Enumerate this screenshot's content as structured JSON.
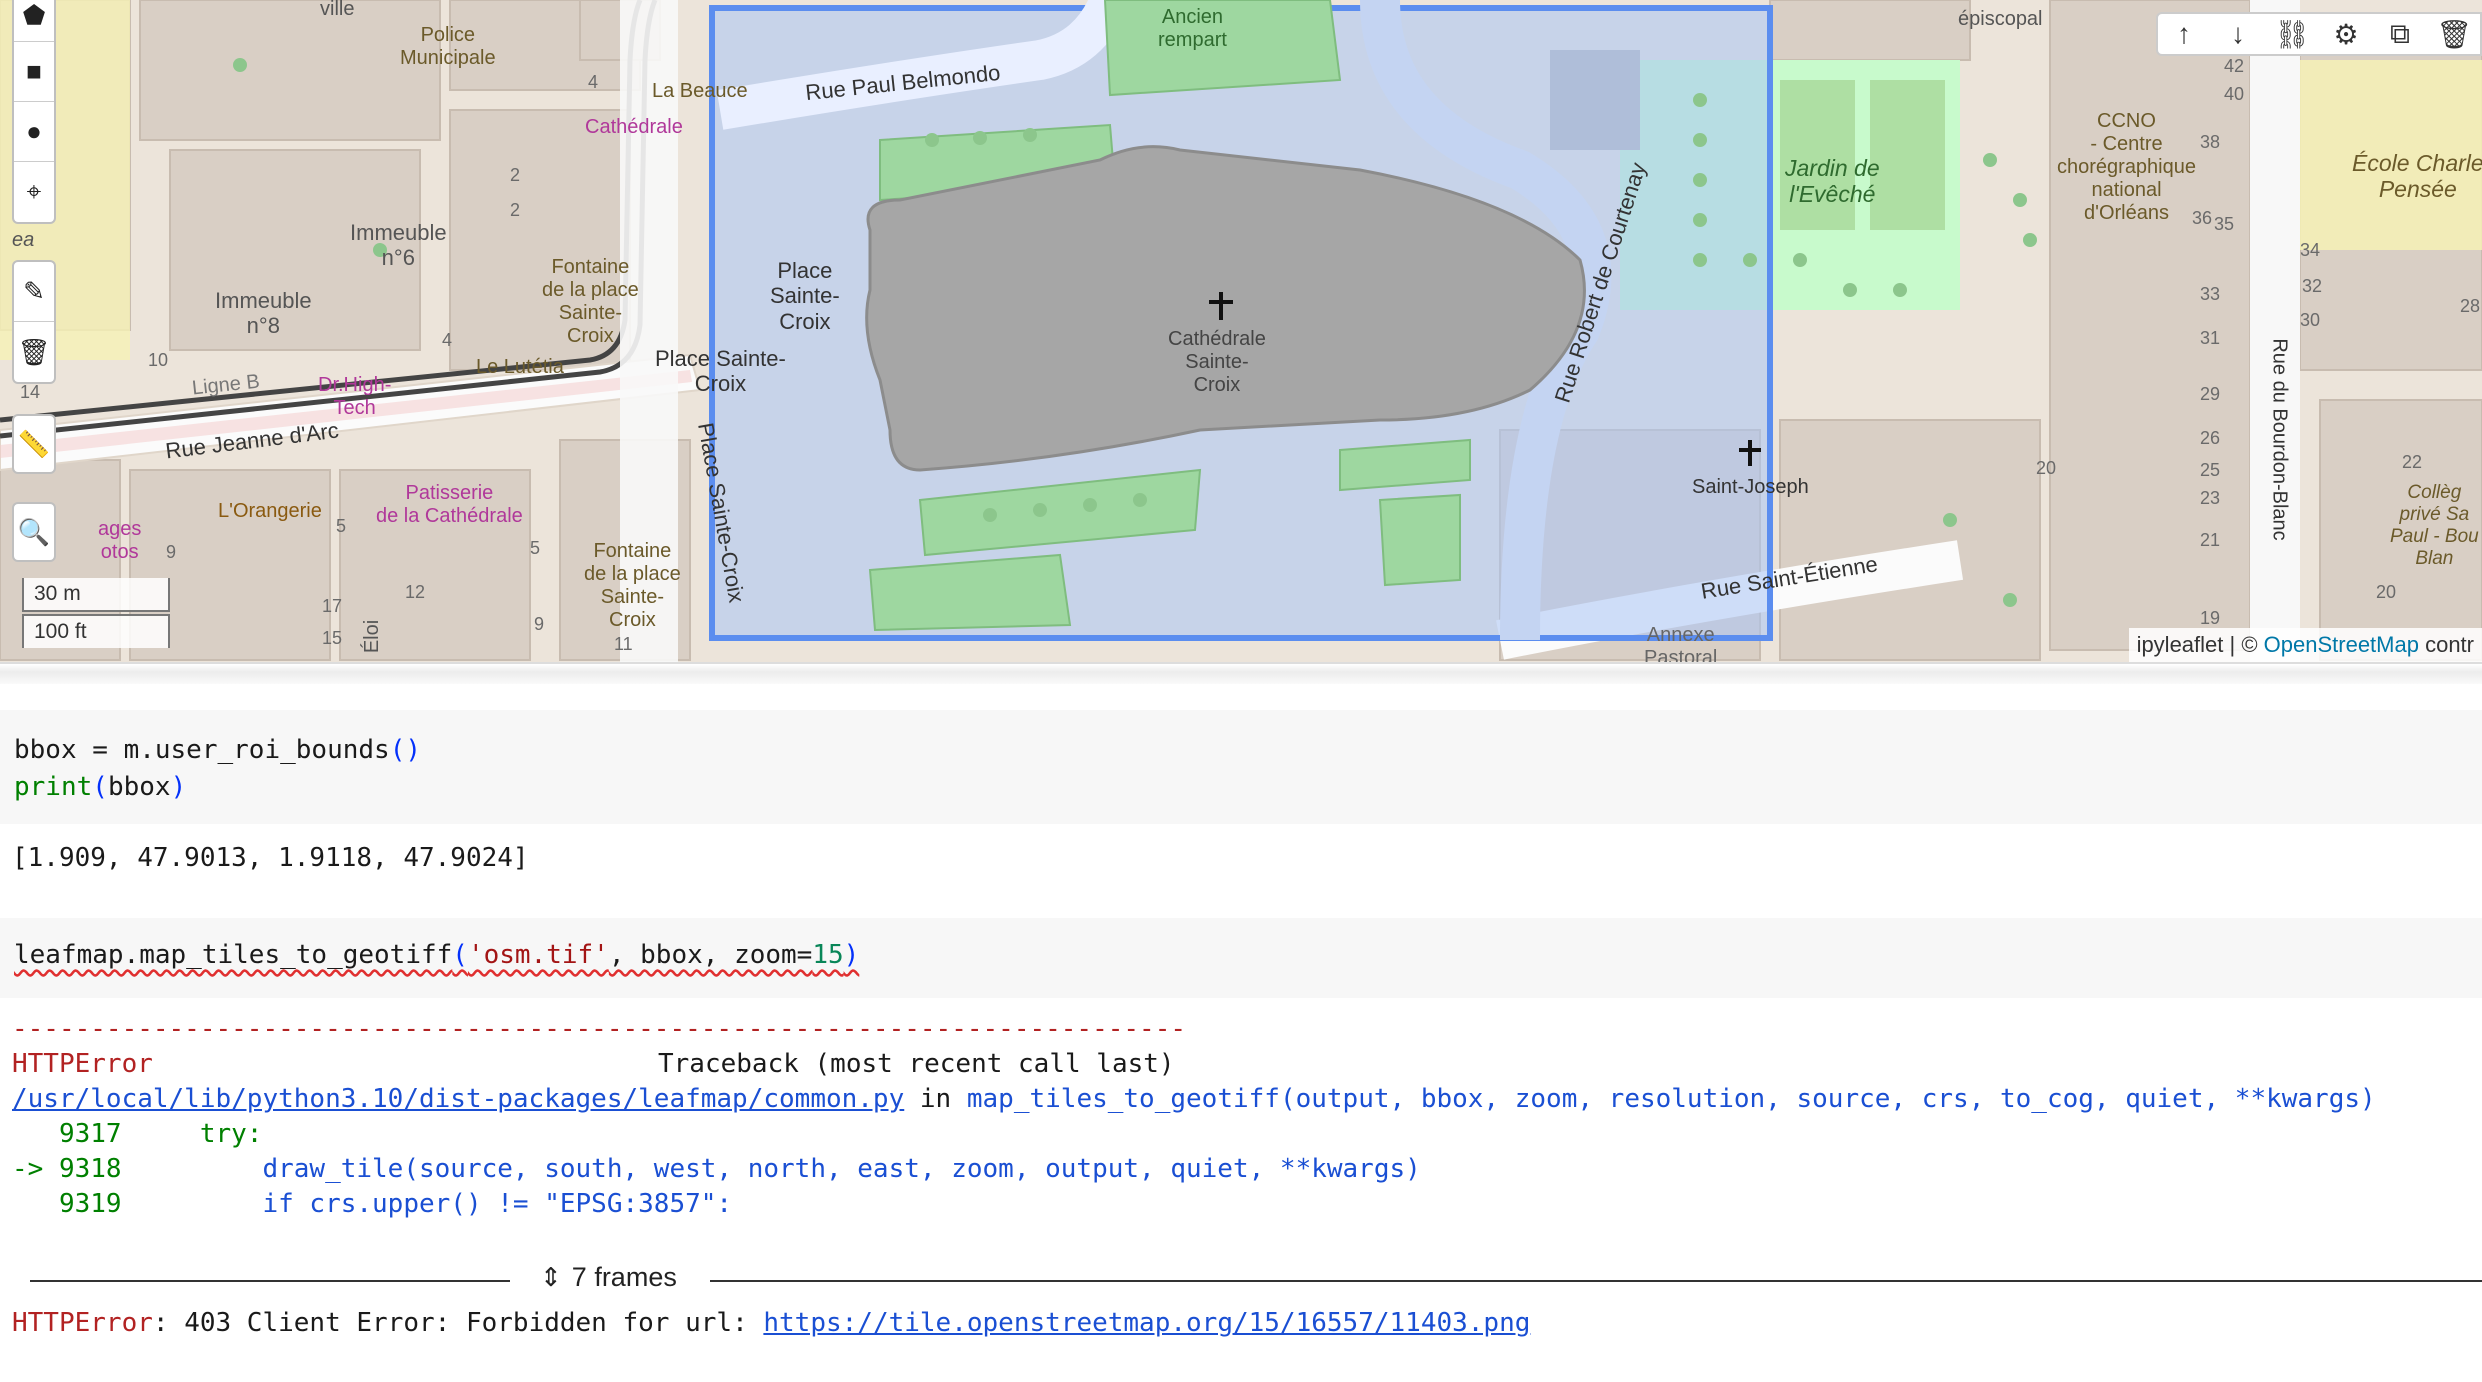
{
  "map": {
    "top_toolbar": [
      "arrow-up-icon",
      "arrow-down-icon",
      "link-icon",
      "gear-icon",
      "layers-icon",
      "trash-icon"
    ],
    "draw_toolbar": [
      "polygon-icon",
      "rectangle-icon",
      "circle-icon",
      "marker-icon",
      "edit-icon",
      "delete-icon"
    ],
    "scale": {
      "metric": "30 m",
      "imperial": "100 ft"
    },
    "attribution": {
      "prefix": "ipyleaflet | © ",
      "link": "OpenStreetMap",
      "suffix": " contr"
    },
    "labels": {
      "ville": "ville",
      "police": "Police\nMunicipale",
      "cathedrale_small": "Cathédrale",
      "la_beauce": "La Beauce",
      "ancien_rempart": "Ancien\nrempart",
      "episcopal": "épiscopal",
      "rue_paul_belmondo": "Rue Paul Belmondo",
      "immeuble_n6": "Immeuble\nn°6",
      "immeuble_n8": "Immeuble\nn°8",
      "fontaine_1": "Fontaine\nde la place\nSainte-\nCroix",
      "le_lutetia": "Le Lutétia",
      "ligne_b": "Ligne B",
      "dr_high_tech": "Dr.High-\nTech",
      "rue_jeanne": "Rue Jeanne d'Arc",
      "lorangerie": "L'Orangerie",
      "patisserie": "Patisserie\nde la Cathédrale",
      "ages_otos": "ages\notos",
      "fontaine_2": "Fontaine\nde la place\nSainte-\nCroix",
      "place_sainte_croix_1": "Place\nSainte-\nCroix",
      "place_sainte_croix_2": "Place Sainte-\nCroix",
      "place_sainte_croix_3": "Place Sainte-Croix",
      "cathedrale_main": "Cathédrale\nSainte-\nCroix",
      "rue_robert": "Rue Robert de Courtenay",
      "jardin": "Jardin de\nl'Evêché",
      "ccno": "CCNO\n- Centre\nchorégraphique\nnational\nd'Orléans",
      "ecole": "École Charle\nPensée",
      "saint_joseph": "Saint-Joseph",
      "rue_saint_etienne": "Rue Saint-Étienne",
      "rue_bourdon": "Rue du Bourdon-Blanc",
      "college": "Collèg\nprivé Sa\nPaul - Bou\nBlan",
      "annexe": "Annexe\nPastoral",
      "eloi": "Éloi",
      "en_es": "en\nes\ner\nea"
    },
    "house_numbers": [
      "4",
      "2",
      "2",
      "4",
      "10",
      "14",
      "9",
      "5",
      "5",
      "12",
      "17",
      "15",
      "9",
      "11",
      "42",
      "40",
      "38",
      "35",
      "36",
      "34",
      "33",
      "32",
      "30",
      "31",
      "28",
      "29",
      "26",
      "25",
      "23",
      "21",
      "22",
      "20",
      "20",
      "19"
    ]
  },
  "cells": {
    "cell1": {
      "line1": [
        "bbox = m.user_roi_bounds",
        "()"
      ],
      "line2": [
        "print",
        "(",
        "bbox",
        ")"
      ]
    },
    "output1": "[1.909, 47.9013, 1.9118, 47.9024]",
    "cell2": {
      "fn": "leafmap.map_tiles_to_geotiff",
      "open": "(",
      "arg1": "'osm.tif'",
      "comma1": ", bbox, zoom=",
      "zoom": "15",
      "close": ")"
    }
  },
  "traceback": {
    "dashes": "---------------------------------------------------------------------------",
    "error_name": "HTTPError",
    "header_right": "Traceback (most recent call last)",
    "file_path": "/usr/local/lib/python3.10/dist-packages/leafmap/common.py",
    "in_word": " in ",
    "func_sig": "map_tiles_to_geotiff(output, bbox, zoom, resolution, source, crs, to_cog, quiet, **kwargs)",
    "lines": [
      {
        "prefix": "   9317     ",
        "code": "try:"
      },
      {
        "prefix": "-> 9318         ",
        "code": "draw_tile(source, south, west, north, east, zoom, output, quiet, **kwargs)"
      },
      {
        "prefix": "   9319         ",
        "code": "if crs.upper() != \"EPSG:3857\":"
      }
    ],
    "frames_label": "7 frames",
    "final_error_name": "HTTPError",
    "final_message": ": 403 Client Error: Forbidden for url: ",
    "final_url": "https://tile.openstreetmap.org/15/16557/11403.png"
  },
  "colors": {
    "roi_fill": "#a9c4f5",
    "roi_stroke": "#5b8def",
    "park": "#c8facc",
    "building": "#d9d0c9",
    "cathedral": "#a6a6a6"
  }
}
